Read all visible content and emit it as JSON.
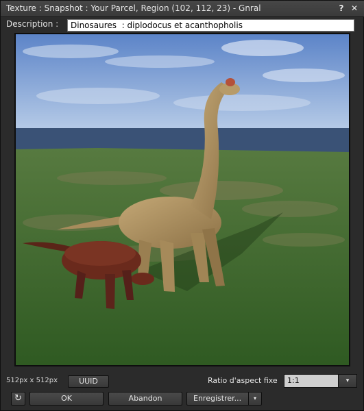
{
  "window": {
    "title": "Texture : Snapshot : Your Parcel, Region (102, 112, 23) - Gnral",
    "help_label": "?",
    "close_label": "✕"
  },
  "description": {
    "label": "Description :",
    "value": "Dinosaures  : diplodocus et acanthopholis"
  },
  "image": {
    "dimensions": "512px x 512px"
  },
  "buttons": {
    "uuid_label": "UUID",
    "ok_label": "OK",
    "cancel_label": "Abandon",
    "save_label": "Enregistrer...",
    "refresh_icon": "↻",
    "dropdown_icon": "▾"
  },
  "ratio": {
    "label": "Ratio d'aspect fixe",
    "value": "1:1",
    "dropdown_icon": "▾"
  },
  "colors": {
    "window_bg": "#2b2b2b",
    "sky_top": "#5c84c8",
    "sky_bottom": "#b3c8e6",
    "water": "#3a5276",
    "grass": "#3e6a2c",
    "brachiosaurus": "#b79b69",
    "acanthopholis": "#6a2a1c"
  }
}
